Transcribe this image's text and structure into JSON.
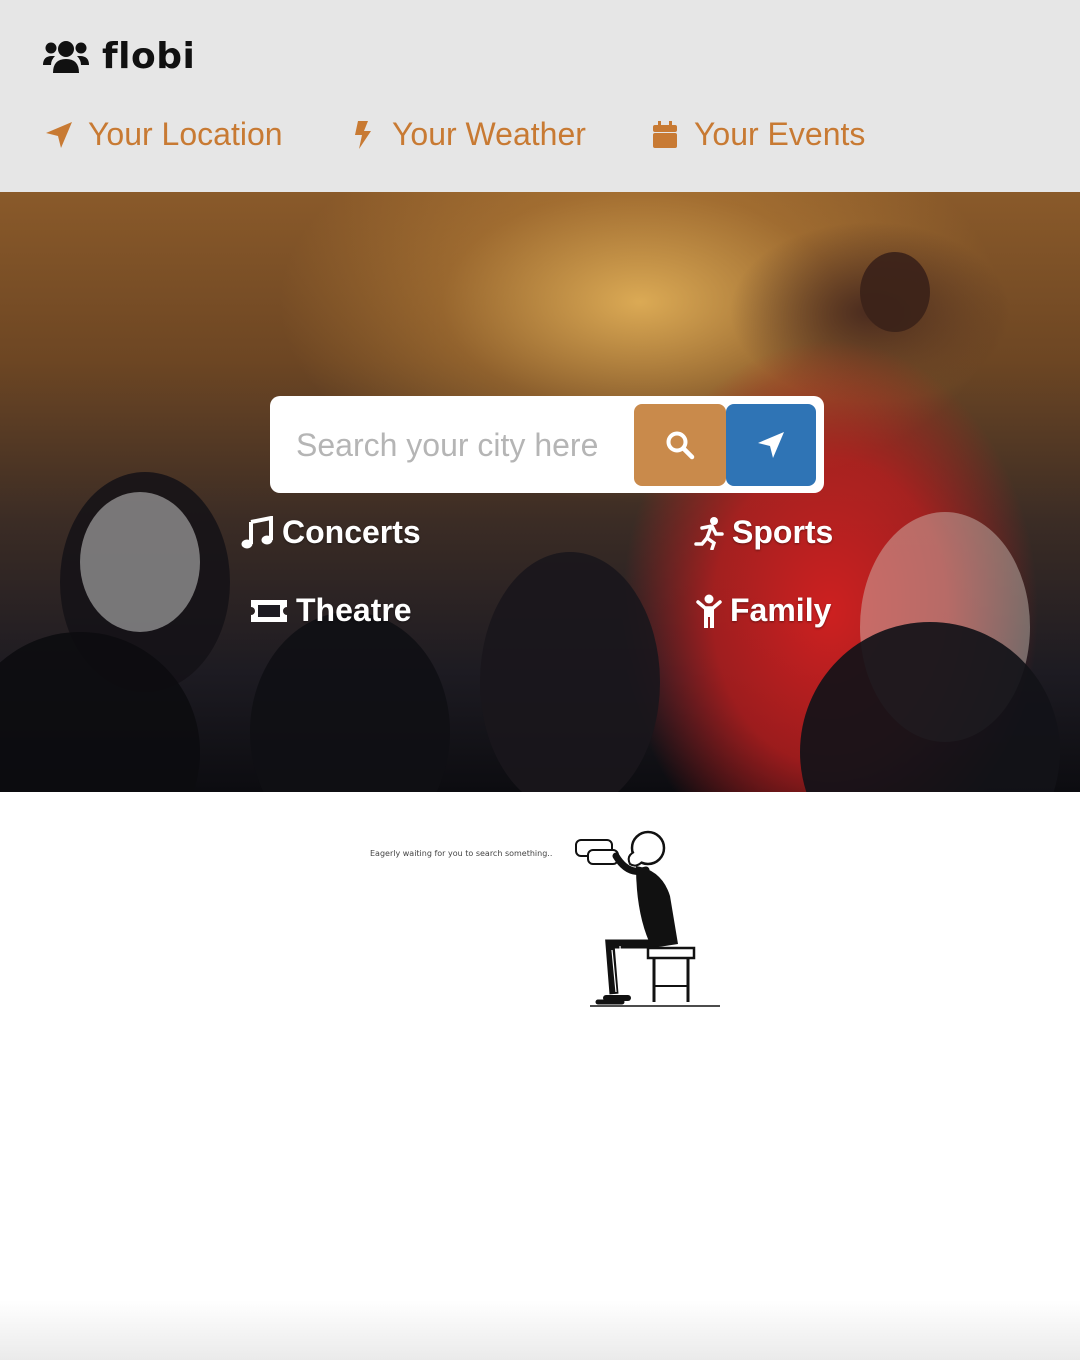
{
  "brand": {
    "name": "flobi",
    "icon": "users-icon"
  },
  "nav": {
    "items": [
      {
        "label": "Your Location",
        "icon": "location-arrow-icon"
      },
      {
        "label": "Your Weather",
        "icon": "bolt-icon"
      },
      {
        "label": "Your Events",
        "icon": "calendar-icon"
      }
    ]
  },
  "search": {
    "placeholder": "Search your city here",
    "value": "",
    "search_button_icon": "search-icon",
    "locate_button_icon": "location-arrow-icon"
  },
  "categories": [
    {
      "label": "Concerts",
      "icon": "music-icon"
    },
    {
      "label": "Sports",
      "icon": "running-icon"
    },
    {
      "label": "Theatre",
      "icon": "ticket-icon"
    },
    {
      "label": "Family",
      "icon": "child-icon"
    }
  ],
  "empty_state": {
    "caption": "Eagerly waiting for you to search something..",
    "illustration": "man-with-binoculars"
  },
  "colors": {
    "header_bg": "#e6e6e6",
    "nav_accent": "#c87a33",
    "search_button": "#c98a4b",
    "locate_button": "#2f74b5"
  }
}
